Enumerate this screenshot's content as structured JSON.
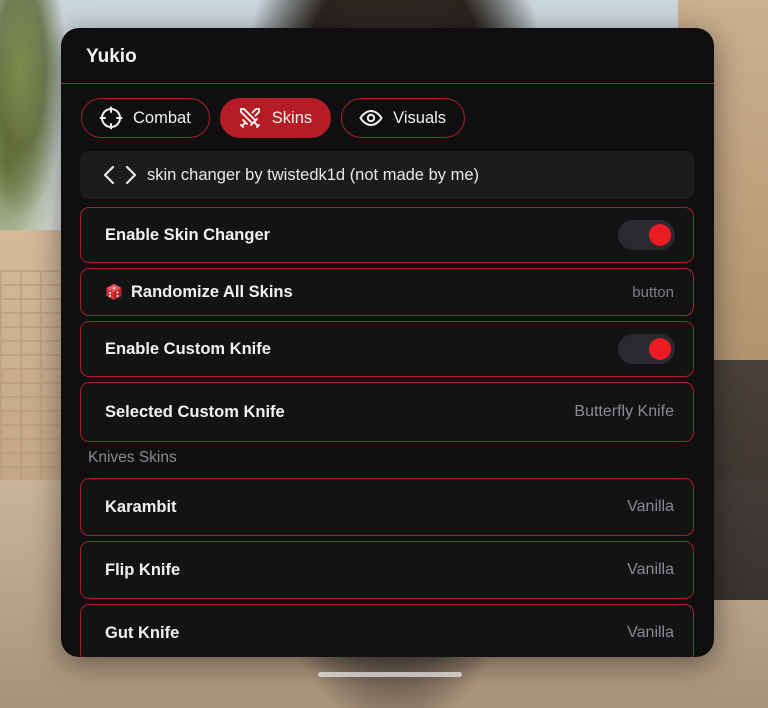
{
  "window": {
    "title": "Yukio"
  },
  "tabs": [
    {
      "label": "Combat",
      "icon": "crosshair-icon",
      "active": false
    },
    {
      "label": "Skins",
      "icon": "crossed-swords-icon",
      "active": true
    },
    {
      "label": "Visuals",
      "icon": "eye-icon",
      "active": false
    }
  ],
  "info": {
    "icon": "code-brackets-icon",
    "text": "skin changer by twistedk1d (not made by me)"
  },
  "rows": {
    "enable_skin_changer": {
      "label": "Enable Skin Changer",
      "enabled": true
    },
    "randomize": {
      "icon": "dice-icon",
      "label": "Randomize All Skins",
      "hint": "button"
    },
    "enable_custom_knife": {
      "label": "Enable Custom Knife",
      "enabled": true
    },
    "selected_knife": {
      "label": "Selected Custom Knife",
      "value": "Butterfly Knife"
    }
  },
  "knives_section": {
    "title": "Knives Skins",
    "items": [
      {
        "label": "Karambit",
        "value": "Vanilla"
      },
      {
        "label": "Flip Knife",
        "value": "Vanilla"
      },
      {
        "label": "Gut Knife",
        "value": "Vanilla"
      }
    ]
  },
  "colors": {
    "accent": "#b51c25",
    "border": "#a8202a",
    "toggle_on": "#ea1b23",
    "panel_bg": "#0f0f11"
  }
}
